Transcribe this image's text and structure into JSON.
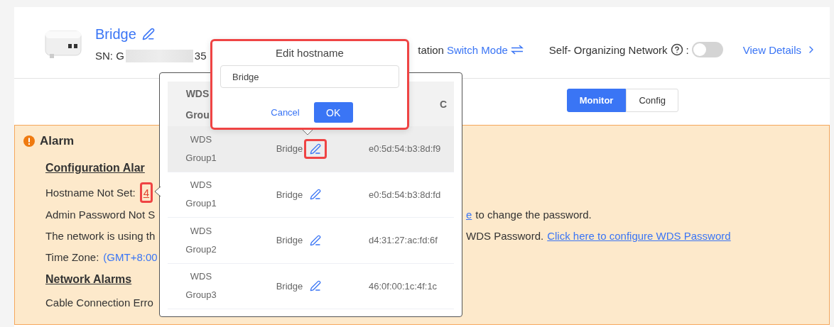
{
  "device": {
    "name": "Bridge",
    "sn_start": "SN: G",
    "sn_end": "35"
  },
  "header": {
    "mode_text": "tation",
    "switch_mode": "Switch Mode",
    "self_org_label": "Self- Organizing Network",
    "colon": ":",
    "self_org_on": false,
    "view_details": "View Details"
  },
  "view_tabs": [
    {
      "label": "Monitor",
      "selected": true
    },
    {
      "label": "Config",
      "selected": false
    }
  ],
  "alarm": {
    "title": "Alarm",
    "lines": [
      {
        "kind": "heading",
        "text": "Configuration Alar"
      },
      {
        "kind": "line",
        "left": [
          {
            "kind": "text",
            "text": "Hostname Not Set:"
          },
          {
            "kind": "count",
            "text": "4",
            "highlighted": true
          }
        ]
      },
      {
        "kind": "line",
        "left": [
          {
            "kind": "text",
            "text": "Admin Password Not S"
          }
        ],
        "right": [
          {
            "kind": "link",
            "text": "e"
          },
          {
            "kind": "text",
            "text": "to change the password."
          }
        ]
      },
      {
        "kind": "line",
        "left": [
          {
            "kind": "text",
            "text": "The network is using th"
          }
        ],
        "right": [
          {
            "kind": "text",
            "text": "WDS Password."
          },
          {
            "kind": "link",
            "text": "Click here to configure WDS Password"
          }
        ]
      },
      {
        "kind": "line",
        "left": [
          {
            "kind": "text",
            "text": "Time Zone:"
          },
          {
            "kind": "value",
            "text": "(GMT+8:00"
          }
        ]
      },
      {
        "kind": "heading",
        "text": "Network Alarms"
      },
      {
        "kind": "line",
        "left": [
          {
            "kind": "text",
            "text": "Cable Connection Erro"
          }
        ]
      }
    ]
  },
  "popover": {
    "group_header": "WDS Grou",
    "mac_header": "C",
    "rows": [
      {
        "group": "WDS Group1",
        "hostname": "Bridge",
        "mac": "e0:5d:54:b3:8d:f9",
        "selected": true,
        "edit_highlighted": true
      },
      {
        "group": "WDS Group1",
        "hostname": "Bridge",
        "mac": "e0:5d:54:b3:8d:fd",
        "selected": false,
        "edit_highlighted": false
      },
      {
        "group": "WDS Group2",
        "hostname": "Bridge",
        "mac": "d4:31:27:ac:fd:6f",
        "selected": false,
        "edit_highlighted": false
      },
      {
        "group": "WDS Group3",
        "hostname": "Bridge",
        "mac": "46:0f:00:1c:4f:1c",
        "selected": false,
        "edit_highlighted": false
      }
    ]
  },
  "dialog": {
    "title": "Edit hostname",
    "value": "Bridge",
    "cancel": "Cancel",
    "ok": "OK",
    "highlighted": true
  }
}
